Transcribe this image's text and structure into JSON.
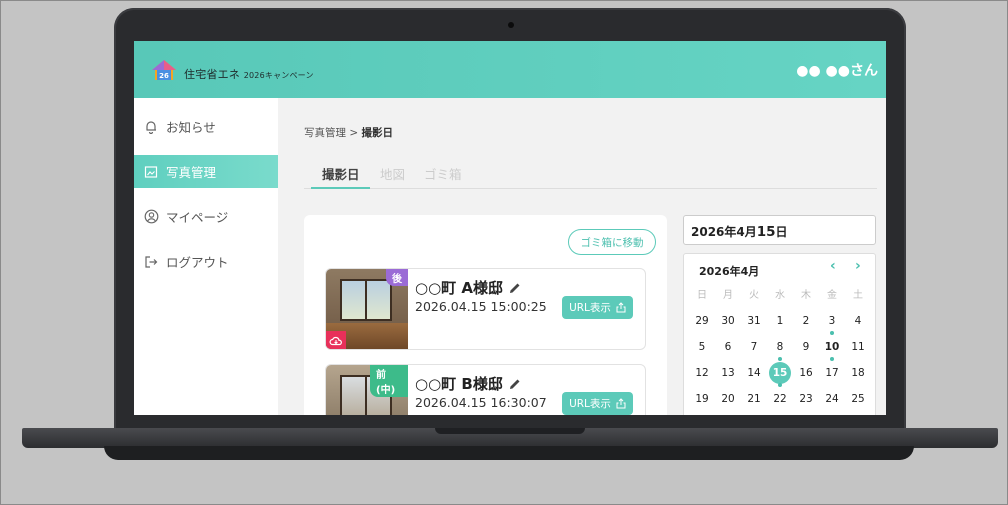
{
  "header": {
    "logo_number": "26",
    "title_main": "住宅省エネ",
    "title_year": "2026",
    "title_suffix": "キャンペーン",
    "user": "●● ●●さん"
  },
  "sidebar": {
    "items": [
      {
        "label": "お知らせ",
        "icon": "bell-icon",
        "active": false
      },
      {
        "label": "写真管理",
        "icon": "photo-icon",
        "active": true
      },
      {
        "label": "マイページ",
        "icon": "user-circle-icon",
        "active": false
      },
      {
        "label": "ログアウト",
        "icon": "logout-icon",
        "active": false
      }
    ]
  },
  "breadcrumb": {
    "parent": "写真管理",
    "separator": " > ",
    "current": "撮影日"
  },
  "tabs": [
    "撮影日",
    "地図",
    "ゴミ箱"
  ],
  "trash_button": "ゴミ箱に移動",
  "cards": [
    {
      "badge": "後",
      "title": "○○町 A様邸",
      "date": "2026.04.15 15:00:25",
      "url_label": "URL表示"
    },
    {
      "badge": "前(中)",
      "title": "○○町 B様邸",
      "date": "2026.04.15 16:30:07",
      "url_label": "URL表示"
    }
  ],
  "date_field": {
    "prefix": "2026年4月",
    "day": "15",
    "suffix": "日"
  },
  "calendar": {
    "month_label": "2026年4月",
    "prev": "‹",
    "next": "›",
    "weekdays": [
      "日",
      "月",
      "火",
      "水",
      "木",
      "金",
      "土"
    ],
    "rows": [
      [
        "29",
        "30",
        "31",
        "1",
        "2",
        "3",
        "4"
      ],
      [
        "5",
        "6",
        "7",
        "8",
        "9",
        "10",
        "11"
      ],
      [
        "12",
        "13",
        "14",
        "15",
        "16",
        "17",
        "18"
      ],
      [
        "19",
        "20",
        "21",
        "22",
        "23",
        "24",
        "25"
      ]
    ],
    "selected": "15",
    "bold_days": [
      "10"
    ],
    "dot_days": [
      "3",
      "8",
      "10",
      "15"
    ]
  },
  "colors": {
    "accent": "#5ccab9",
    "after_badge": "#9b6bd6",
    "before_badge": "#3dbb8a",
    "cloud": "#e8305a"
  }
}
